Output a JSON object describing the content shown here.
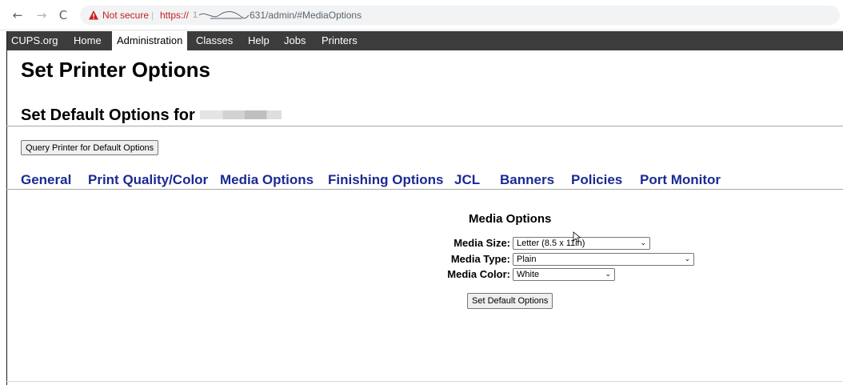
{
  "browser": {
    "back_icon": "←",
    "forward_icon": "→",
    "reload_icon": "C",
    "security_text": "Not secure",
    "url_scheme": "https://",
    "url_path": "631/admin/#MediaOptions"
  },
  "cups_nav": {
    "items": [
      {
        "label": "CUPS.org",
        "active": false
      },
      {
        "label": "Home",
        "active": false
      },
      {
        "label": "Administration",
        "active": true
      },
      {
        "label": "Classes",
        "active": false
      },
      {
        "label": "Help",
        "active": false
      },
      {
        "label": "Jobs",
        "active": false
      },
      {
        "label": "Printers",
        "active": false
      }
    ]
  },
  "page": {
    "title": "Set Printer Options",
    "section_title": "Set Default Options for",
    "query_button": "Query Printer for Default Options"
  },
  "tabs": [
    "General",
    "Print Quality/Color",
    "Media Options",
    "Finishing Options",
    "JCL",
    "Banners",
    "Policies",
    "Port Monitor"
  ],
  "media_options": {
    "heading": "Media Options",
    "fields": [
      {
        "label": "Media Size:",
        "value": "Letter (8.5 x 11in)"
      },
      {
        "label": "Media Type:",
        "value": "Plain"
      },
      {
        "label": "Media Color:",
        "value": "White"
      }
    ],
    "submit_button": "Set Default Options"
  },
  "colors": {
    "nav_background": "#3c3c3c",
    "tab_link": "#1b2a93",
    "warning_red": "#c5221f"
  }
}
